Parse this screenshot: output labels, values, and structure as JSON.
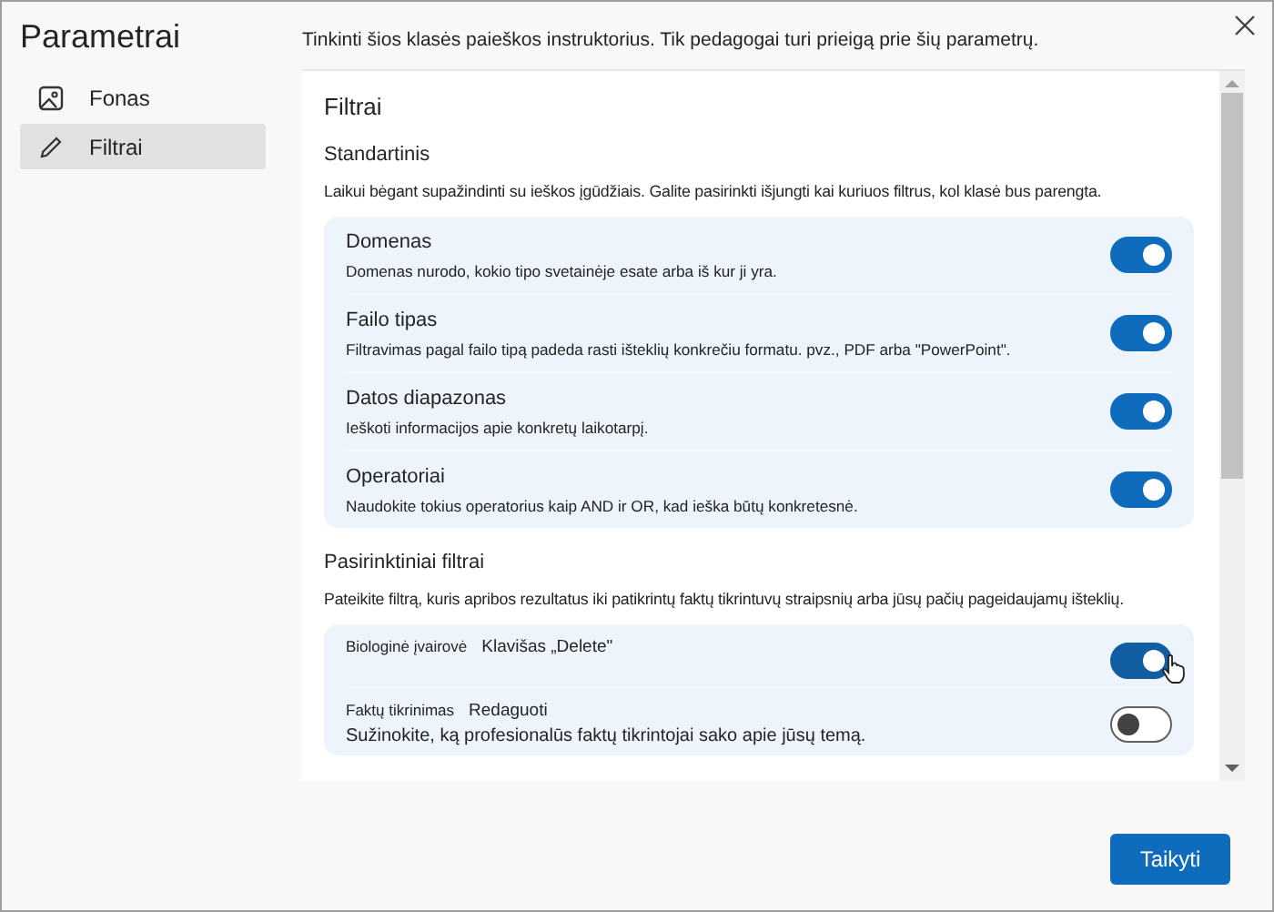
{
  "sidebar": {
    "title": "Parametrai",
    "items": [
      {
        "label": "Fonas",
        "selected": false
      },
      {
        "label": "Filtrai",
        "selected": true
      }
    ]
  },
  "header": {
    "text": "Tinkinti šios klasės paieškos instruktorius. Tik pedagogai turi prieigą prie šių parametrų."
  },
  "panel": {
    "title": "Filtrai",
    "sections": [
      {
        "heading": "Standartinis",
        "description": "Laikui bėgant supažindinti su ieškos įgūdžiais. Galite pasirinkti išjungti kai kuriuos filtrus, kol klasė bus parengta.",
        "filters": [
          {
            "name": "Domenas",
            "description": "Domenas nurodo, kokio tipo svetainėje esate arba iš kur ji yra.",
            "on": true,
            "hovered": false
          },
          {
            "name": "Failo tipas",
            "description": "Filtravimas pagal failo tipą padeda rasti išteklių konkrečiu formatu. pvz., PDF arba \"PowerPoint\".",
            "on": true,
            "hovered": false
          },
          {
            "name": "Datos diapazonas",
            "description": "Ieškoti informacijos apie konkretų laikotarpį.",
            "on": true,
            "hovered": false
          },
          {
            "name": "Operatoriai",
            "description": "Naudokite tokius operatorius kaip AND ir OR, kad ieška būtų konkretesnė.",
            "on": true,
            "hovered": false
          }
        ]
      },
      {
        "heading": "Pasirinktiniai filtrai",
        "description": "Pateikite filtrą, kuris apribos rezultatus iki patikrintų faktų tikrintuvų straipsnių arba jūsų pačių pageidaujamų išteklių.",
        "filters": [
          {
            "name": "Biologinė įvairovė",
            "note": "Klavišas „Delete\"",
            "on": true,
            "hovered": true
          },
          {
            "name": "Faktų tikrinimas",
            "note": "Redaguoti",
            "description": "Sužinokite, ką profesionalūs faktų tikrintojai sako apie jūsų temą.",
            "on": false,
            "hovered": false
          }
        ]
      }
    ]
  },
  "footer": {
    "button": "Taikyti"
  }
}
